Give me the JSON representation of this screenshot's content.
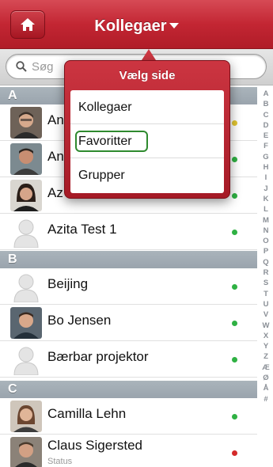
{
  "navbar": {
    "title": "Kollegaer",
    "home_icon": "home-icon"
  },
  "search": {
    "placeholder": "Søg"
  },
  "popover": {
    "title": "Vælg side",
    "items": [
      "Kollegaer",
      "Favoritter",
      "Grupper"
    ],
    "focused_item": "Favoritter"
  },
  "sections": [
    {
      "letter": "A",
      "rows": [
        {
          "name": "An",
          "presence": "away",
          "avatar": "photo"
        },
        {
          "name": "An",
          "presence": "available",
          "avatar": "photo"
        },
        {
          "name": "Az",
          "presence": "available",
          "avatar": "photo"
        },
        {
          "name": "Azita Test 1",
          "presence": "available",
          "avatar": "placeholder"
        }
      ]
    },
    {
      "letter": "B",
      "rows": [
        {
          "name": "Beijing",
          "presence": "available",
          "avatar": "placeholder"
        },
        {
          "name": "Bo Jensen",
          "presence": "available",
          "avatar": "photo"
        },
        {
          "name": "Bærbar projektor",
          "presence": "available",
          "avatar": "placeholder"
        }
      ]
    },
    {
      "letter": "C",
      "rows": [
        {
          "name": "Camilla Lehn",
          "presence": "available",
          "avatar": "photo"
        },
        {
          "name": "Claus Sigersted",
          "status": "Status",
          "presence": "busy",
          "avatar": "photo"
        }
      ]
    }
  ],
  "index_letters": [
    "A",
    "B",
    "C",
    "D",
    "E",
    "F",
    "G",
    "H",
    "I",
    "J",
    "K",
    "L",
    "M",
    "N",
    "O",
    "P",
    "Q",
    "R",
    "S",
    "T",
    "U",
    "V",
    "W",
    "X",
    "Y",
    "Z",
    "Æ",
    "Ø",
    "Å",
    "#"
  ],
  "colors": {
    "accent": "#c32633",
    "available": "#2fb143",
    "away": "#e1c531",
    "busy": "#d42a2a",
    "focus_ring": "#2f8a2f"
  }
}
